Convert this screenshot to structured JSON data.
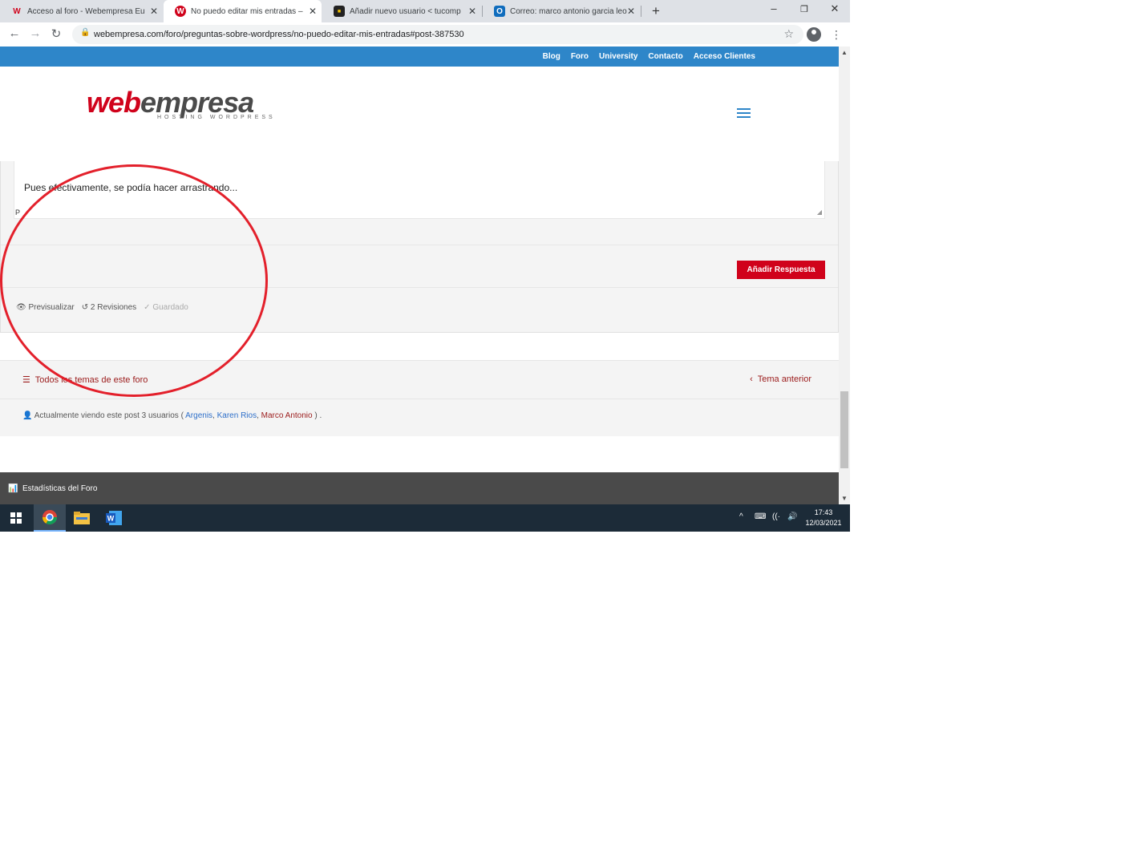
{
  "browser": {
    "tabs": [
      {
        "title": "Acceso al foro - Webempresa Eu",
        "favicon": "W"
      },
      {
        "title": "No puedo editar mis entradas – ",
        "favicon": "W"
      },
      {
        "title": "Añadir nuevo usuario < tucomp",
        "favicon": "■"
      },
      {
        "title": "Correo: marco antonio garcia leo",
        "favicon": "O"
      }
    ],
    "new_tab": "+",
    "url": "webempresa.com/foro/preguntas-sobre-wordpress/no-puedo-editar-mis-entradas#post-387530"
  },
  "site": {
    "topnav": [
      "Blog",
      "Foro",
      "University",
      "Contacto",
      "Acceso Clientes"
    ],
    "logo_main_1": "web",
    "logo_main_2": "empresa",
    "logo_sub": "HOSTING WORDPRESS"
  },
  "reply": {
    "text": "Pues efectivamente, se podía hacer arrastrando...",
    "path_tag": "P",
    "submit_label": "Añadir Respuesta",
    "preview": "Previsualizar",
    "revisions": "2 Revisiones",
    "saved": "Guardado"
  },
  "forum_nav": {
    "all_topics": "Todos los temas de este foro",
    "previous": "Tema anterior"
  },
  "viewers": {
    "prefix": "Actualmente viendo este post 3 usuarios (",
    "users": [
      "Argenis",
      "Karen Rios",
      "Marco Antonio"
    ],
    "suffix": ") ."
  },
  "footer": {
    "stats_label": "Estadísticas del Foro"
  },
  "taskbar": {
    "time": "17:43",
    "date": "12/03/2021"
  },
  "colors": {
    "brand_red": "#d0021b",
    "nav_blue": "#2e86c9",
    "annotation_red": "#e3202b"
  }
}
